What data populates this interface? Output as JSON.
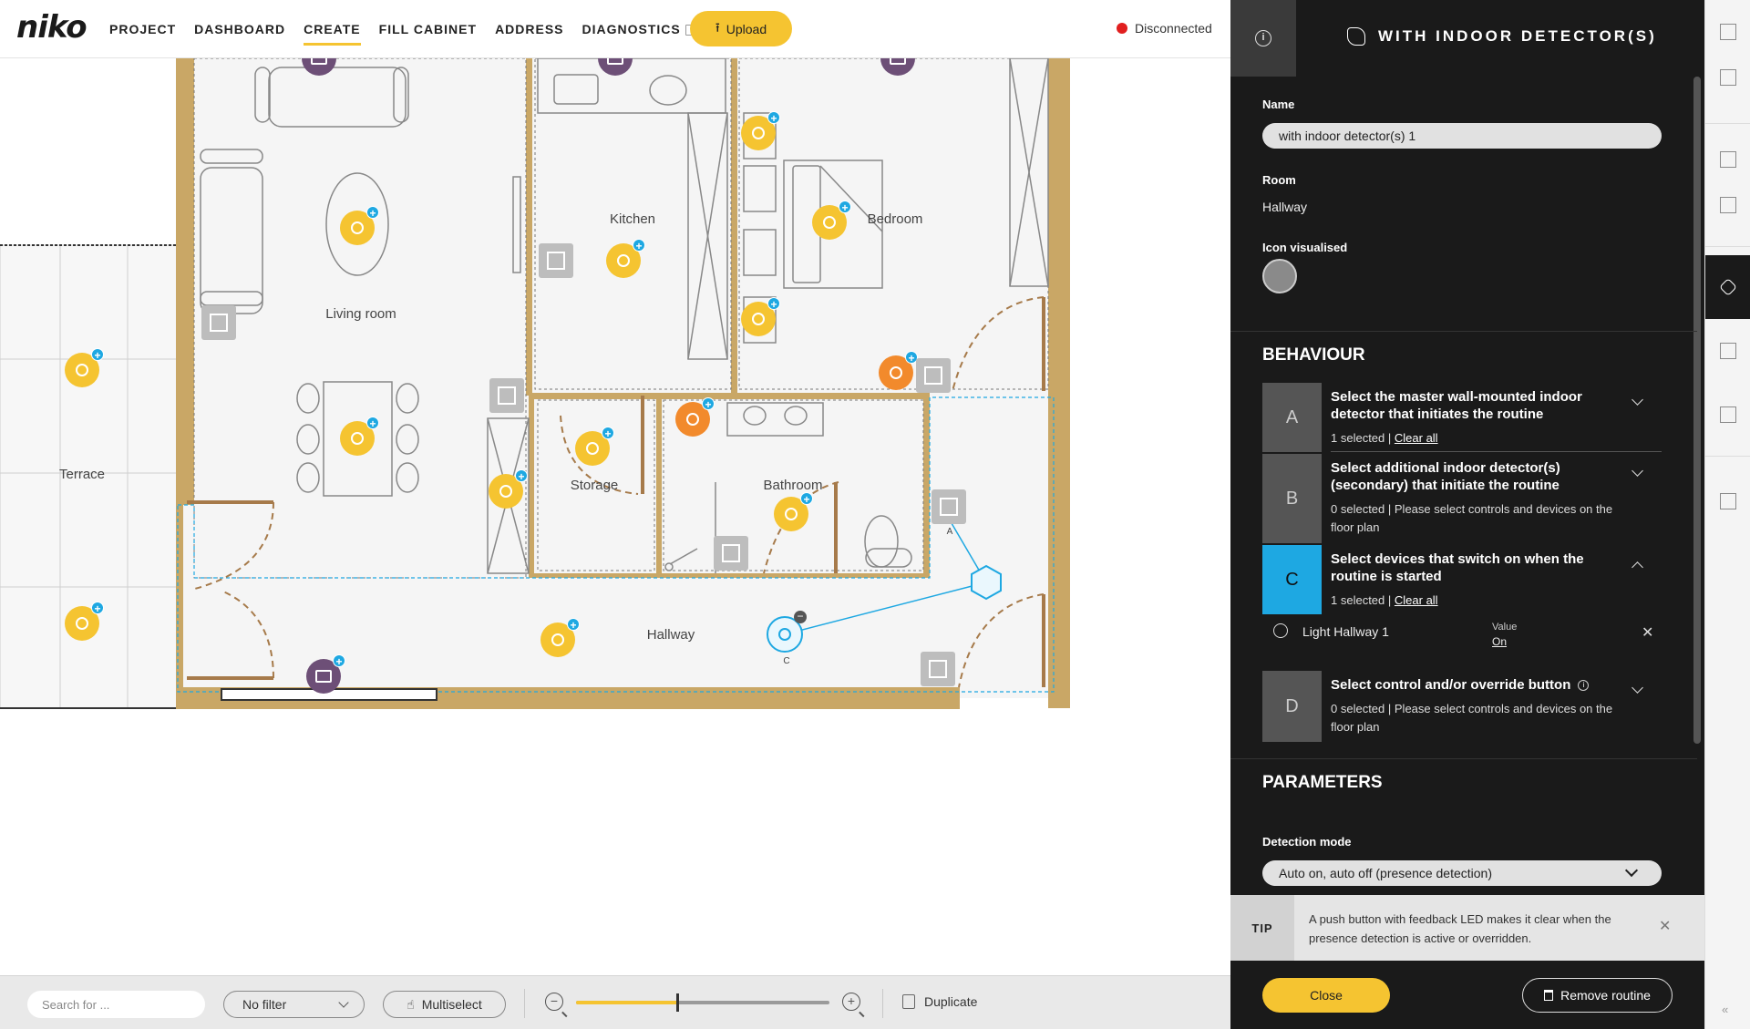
{
  "app": {
    "logo": "niko",
    "nav": [
      "PROJECT",
      "DASHBOARD",
      "CREATE",
      "FILL CABINET",
      "ADDRESS",
      "DIAGNOSTICS"
    ],
    "active_nav": "CREATE",
    "upload_label": "Upload",
    "status_text": "Disconnected",
    "status_color": "#e11f1f",
    "accent_color": "#f5c431",
    "selection_color": "#1ea8e2"
  },
  "floorplan": {
    "rooms": [
      "Terrace",
      "Living room",
      "Kitchen",
      "Bedroom",
      "Storage",
      "Bathroom",
      "Hallway"
    ],
    "markers": [
      "A",
      "C"
    ]
  },
  "toolbar": {
    "search_placeholder": "Search for ...",
    "filter_label": "No filter",
    "multiselect_label": "Multiselect",
    "zoom_level": 0.4,
    "duplicate_label": "Duplicate"
  },
  "panel": {
    "title": "WITH INDOOR DETECTOR(S)",
    "name_label": "Name",
    "name_value": "with indoor detector(s) 1",
    "room_label": "Room",
    "room_value": "Hallway",
    "icon_label": "Icon visualised",
    "behaviour_title": "BEHAVIOUR",
    "behaviour": [
      {
        "letter": "A",
        "title": "Select the master wall-mounted indoor detector that initiates the routine",
        "count": "1 selected |",
        "action": "Clear all",
        "hint": ""
      },
      {
        "letter": "B",
        "title": "Select additional indoor detector(s) (secondary) that initiate the routine",
        "count": "0 selected |",
        "action": "",
        "hint": "Please select controls and devices on the floor plan"
      },
      {
        "letter": "C",
        "title": "Select devices that switch on when the routine is started",
        "count": "1 selected |",
        "action": "Clear all",
        "hint": ""
      },
      {
        "letter": "D",
        "title": "Select control and/or override button",
        "count": "0 selected |",
        "action": "",
        "hint": "Please select controls and devices on the floor plan"
      }
    ],
    "device": {
      "name": "Light Hallway 1",
      "value_label": "Value",
      "value": "On"
    },
    "parameters_title": "PARAMETERS",
    "detection_label": "Detection mode",
    "detection_value": "Auto on, auto off (presence detection)",
    "tip_label": "TIP",
    "tip_text": "A push button with feedback LED makes it clear when the presence detection is active or overridden.",
    "close_label": "Close",
    "remove_label": "Remove routine"
  }
}
